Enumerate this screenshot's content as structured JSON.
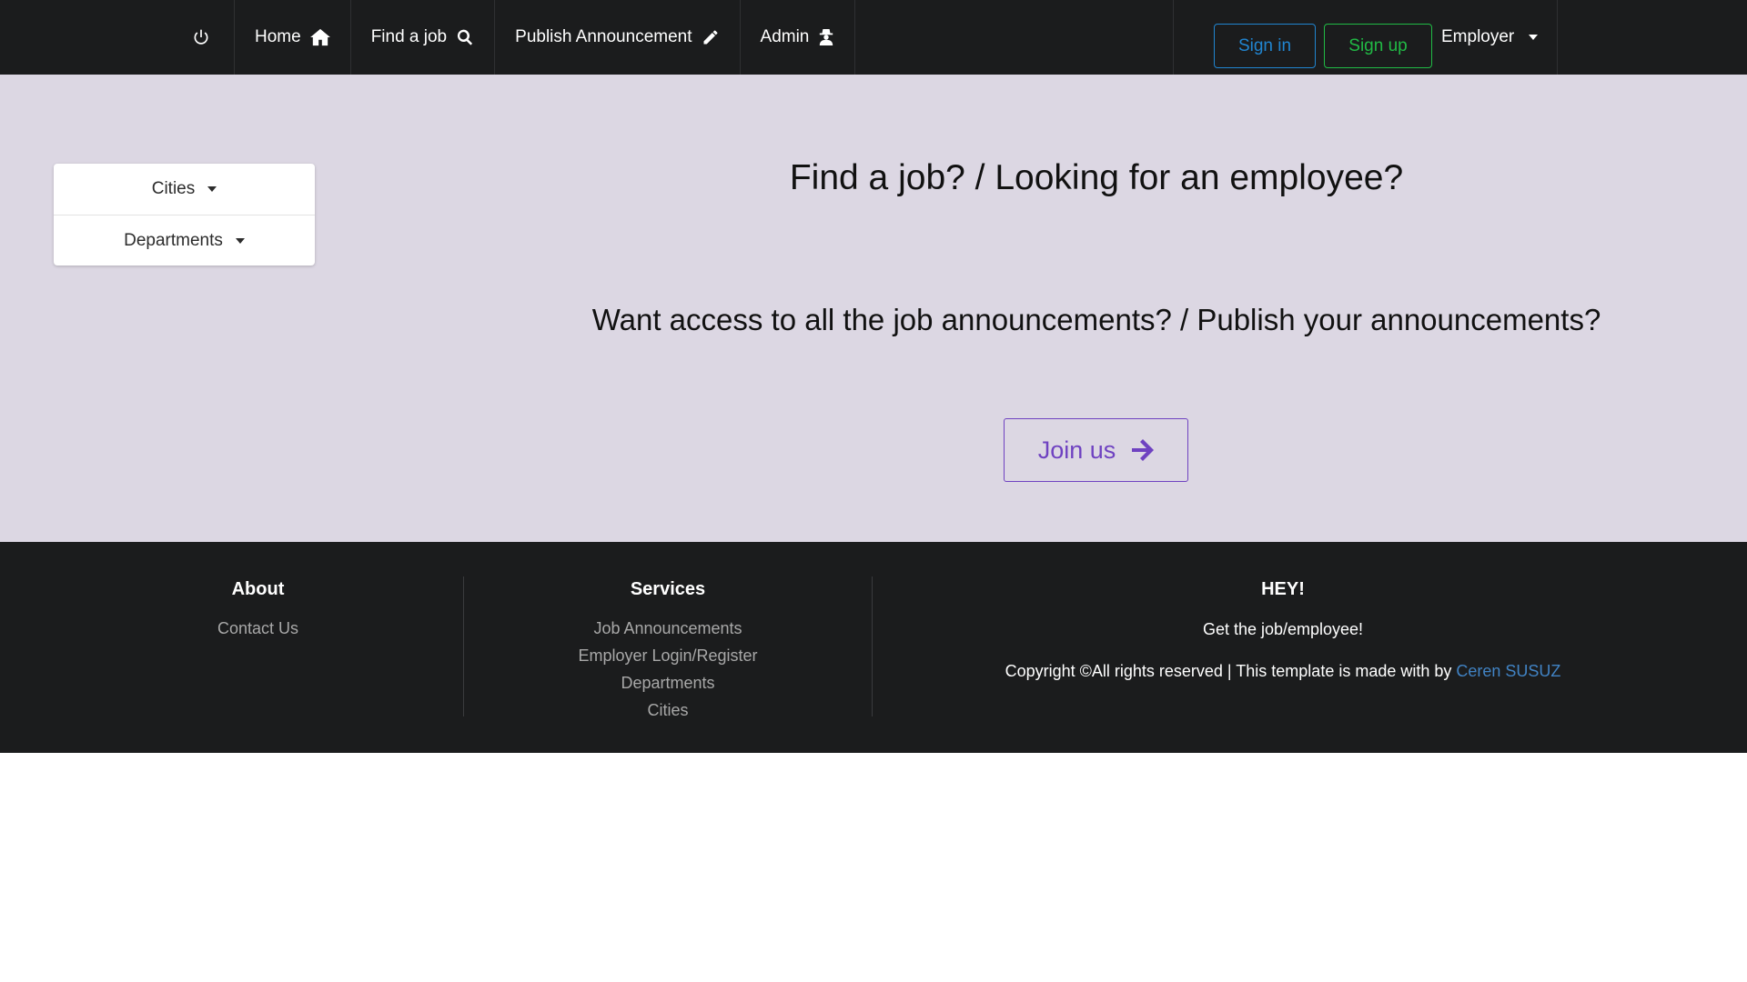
{
  "navbar": {
    "items": [
      {
        "label": "Home",
        "icon": "home-icon"
      },
      {
        "label": "Find a job",
        "icon": "search-icon"
      },
      {
        "label": "Publish Announcement",
        "icon": "pencil-icon"
      },
      {
        "label": "Admin",
        "icon": "user-secret-icon"
      }
    ],
    "power_icon": "power-icon",
    "signin_label": "Sign in",
    "signup_label": "Sign up",
    "user_type_label": "Employer"
  },
  "sidebar": {
    "items": [
      {
        "label": "Cities"
      },
      {
        "label": "Departments"
      }
    ]
  },
  "hero": {
    "headline": "Find a job? / Looking for an employee?",
    "subheadline": "Want access to all the job announcements? / Publish your announcements?",
    "cta_label": "Join us"
  },
  "footer": {
    "about": {
      "title": "About",
      "links": [
        "Contact Us"
      ]
    },
    "services": {
      "title": "Services",
      "links": [
        "Job Announcements",
        "Employer Login/Register",
        "Departments",
        "Cities"
      ]
    },
    "hey": {
      "title": "HEY!",
      "subtitle": "Get the job/employee!",
      "copyright": "Copyright ©All rights reserved | This template is made with by ",
      "author": "Ceren SUSUZ"
    }
  },
  "colors": {
    "navbar_bg": "#1b1c1d",
    "hero_bg": "#dcd7e3",
    "signin": "#2185d0",
    "signup": "#21ba45",
    "cta": "#6f42c1",
    "link": "#4183c4"
  }
}
